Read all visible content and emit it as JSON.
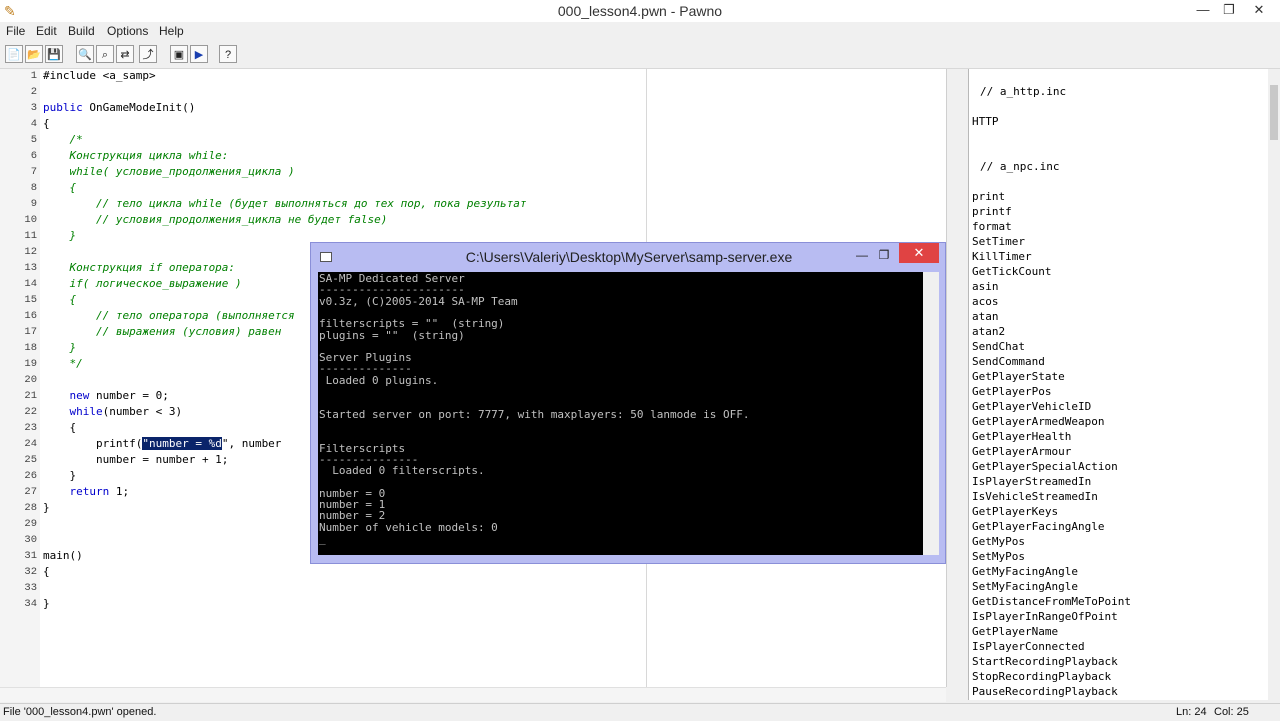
{
  "window": {
    "title": "000_lesson4.pwn - Pawno",
    "minimize": "—",
    "restore": "❐",
    "close": "✕"
  },
  "menu": [
    "File",
    "Edit",
    "Build",
    "Options",
    "Help"
  ],
  "toolbar": [
    {
      "name": "new-file-button",
      "icon": "📄"
    },
    {
      "name": "open-file-button",
      "icon": "📂"
    },
    {
      "name": "save-file-button",
      "icon": "💾"
    },
    {
      "name": "find-button",
      "icon": "🔍"
    },
    {
      "name": "find-next-button",
      "icon": "⌕"
    },
    {
      "name": "replace-button",
      "icon": "⇄"
    },
    {
      "name": "goto-line-button",
      "icon": "⤴"
    },
    {
      "name": "compile-button",
      "icon": "▣"
    },
    {
      "name": "run-button",
      "icon": "▶"
    },
    {
      "name": "help-button",
      "icon": "?"
    }
  ],
  "editor": {
    "lines": [
      {
        "n": "1",
        "segs": [
          {
            "t": "#include <a_samp>"
          }
        ]
      },
      {
        "n": "2",
        "segs": [
          {
            "t": ""
          }
        ]
      },
      {
        "n": "3",
        "segs": [
          {
            "t": "public",
            "c": "kw"
          },
          {
            "t": " OnGameModeInit()"
          }
        ]
      },
      {
        "n": "4",
        "segs": [
          {
            "t": "{"
          }
        ]
      },
      {
        "n": "5",
        "comment": true,
        "segs": [
          {
            "t": "    /*"
          }
        ]
      },
      {
        "n": "6",
        "comment": true,
        "segs": [
          {
            "t": "    Конструкция цикла while:"
          }
        ]
      },
      {
        "n": "7",
        "comment": true,
        "segs": [
          {
            "t": "    while( условие_продолжения_цикла )"
          }
        ]
      },
      {
        "n": "8",
        "comment": true,
        "segs": [
          {
            "t": "    {"
          }
        ]
      },
      {
        "n": "9",
        "comment": true,
        "segs": [
          {
            "t": "        // тело цикла while (будет выполняться до тех пор, пока результат"
          }
        ]
      },
      {
        "n": "10",
        "comment": true,
        "segs": [
          {
            "t": "        // условия_продолжения_цикла не будет false)"
          }
        ]
      },
      {
        "n": "11",
        "comment": true,
        "segs": [
          {
            "t": "    }"
          }
        ]
      },
      {
        "n": "12",
        "comment": true,
        "segs": [
          {
            "t": ""
          }
        ]
      },
      {
        "n": "13",
        "comment": true,
        "segs": [
          {
            "t": "    Конструкция if оператора:"
          }
        ]
      },
      {
        "n": "14",
        "comment": true,
        "segs": [
          {
            "t": "    if( логическое_выражение )"
          }
        ]
      },
      {
        "n": "15",
        "comment": true,
        "segs": [
          {
            "t": "    {"
          }
        ]
      },
      {
        "n": "16",
        "comment": true,
        "segs": [
          {
            "t": "        // тело оператора (выполняется"
          }
        ]
      },
      {
        "n": "17",
        "comment": true,
        "segs": [
          {
            "t": "        // выражения (условия) равен"
          }
        ]
      },
      {
        "n": "18",
        "comment": true,
        "segs": [
          {
            "t": "    }"
          }
        ]
      },
      {
        "n": "19",
        "comment": true,
        "segs": [
          {
            "t": "    */"
          }
        ]
      },
      {
        "n": "20",
        "segs": [
          {
            "t": ""
          }
        ]
      },
      {
        "n": "21",
        "segs": [
          {
            "t": "    "
          },
          {
            "t": "new",
            "c": "kw"
          },
          {
            "t": " number = 0;"
          }
        ]
      },
      {
        "n": "22",
        "segs": [
          {
            "t": "    "
          },
          {
            "t": "while",
            "c": "kw"
          },
          {
            "t": "(number < 3)"
          }
        ]
      },
      {
        "n": "23",
        "segs": [
          {
            "t": "    {"
          }
        ]
      },
      {
        "n": "24",
        "segs": [
          {
            "t": "        printf("
          },
          {
            "t": "\"number = %d",
            "c": "sel"
          },
          {
            "t": "\", number"
          }
        ]
      },
      {
        "n": "25",
        "segs": [
          {
            "t": "        number = number + 1;"
          }
        ]
      },
      {
        "n": "26",
        "segs": [
          {
            "t": "    }"
          }
        ]
      },
      {
        "n": "27",
        "segs": [
          {
            "t": "    "
          },
          {
            "t": "return",
            "c": "kw"
          },
          {
            "t": " 1;"
          }
        ]
      },
      {
        "n": "28",
        "segs": [
          {
            "t": "}"
          }
        ]
      },
      {
        "n": "29",
        "segs": [
          {
            "t": ""
          }
        ]
      },
      {
        "n": "30",
        "segs": [
          {
            "t": ""
          }
        ]
      },
      {
        "n": "31",
        "segs": [
          {
            "t": "main()"
          }
        ]
      },
      {
        "n": "32",
        "segs": [
          {
            "t": "{"
          }
        ]
      },
      {
        "n": "33",
        "segs": [
          {
            "t": ""
          }
        ]
      },
      {
        "n": "34",
        "segs": [
          {
            "t": "}"
          }
        ]
      }
    ]
  },
  "functions_panel": {
    "header1": "// a_http.inc",
    "group1": [
      "HTTP"
    ],
    "header2": "// a_npc.inc",
    "group2": [
      "print",
      "printf",
      "format",
      "SetTimer",
      "KillTimer",
      "GetTickCount",
      "asin",
      "acos",
      "atan",
      "atan2",
      "SendChat",
      "SendCommand",
      "GetPlayerState",
      "GetPlayerPos",
      "GetPlayerVehicleID",
      "GetPlayerArmedWeapon",
      "GetPlayerHealth",
      "GetPlayerArmour",
      "GetPlayerSpecialAction",
      "IsPlayerStreamedIn",
      "IsVehicleStreamedIn",
      "GetPlayerKeys",
      "GetPlayerFacingAngle",
      "GetMyPos",
      "SetMyPos",
      "GetMyFacingAngle",
      "SetMyFacingAngle",
      "GetDistanceFromMeToPoint",
      "IsPlayerInRangeOfPoint",
      "GetPlayerName",
      "IsPlayerConnected",
      "StartRecordingPlayback",
      "StopRecordingPlayback",
      "PauseRecordingPlayback"
    ]
  },
  "status": {
    "message": "File '000_lesson4.pwn' opened.",
    "line": "Ln: 24",
    "col": "Col: 25"
  },
  "console": {
    "title": "C:\\Users\\Valeriy\\Desktop\\MyServer\\samp-server.exe",
    "lines": [
      "SA-MP Dedicated Server",
      "----------------------",
      "v0.3z, (C)2005-2014 SA-MP Team",
      "",
      "filterscripts = \"\"  (string)",
      "plugins = \"\"  (string)",
      "",
      "Server Plugins",
      "--------------",
      " Loaded 0 plugins.",
      "",
      "",
      "Started server on port: 7777, with maxplayers: 50 lanmode is OFF.",
      "",
      "",
      "Filterscripts",
      "---------------",
      "  Loaded 0 filterscripts.",
      "",
      "number = 0",
      "number = 1",
      "number = 2",
      "Number of vehicle models: 0",
      "_"
    ]
  }
}
